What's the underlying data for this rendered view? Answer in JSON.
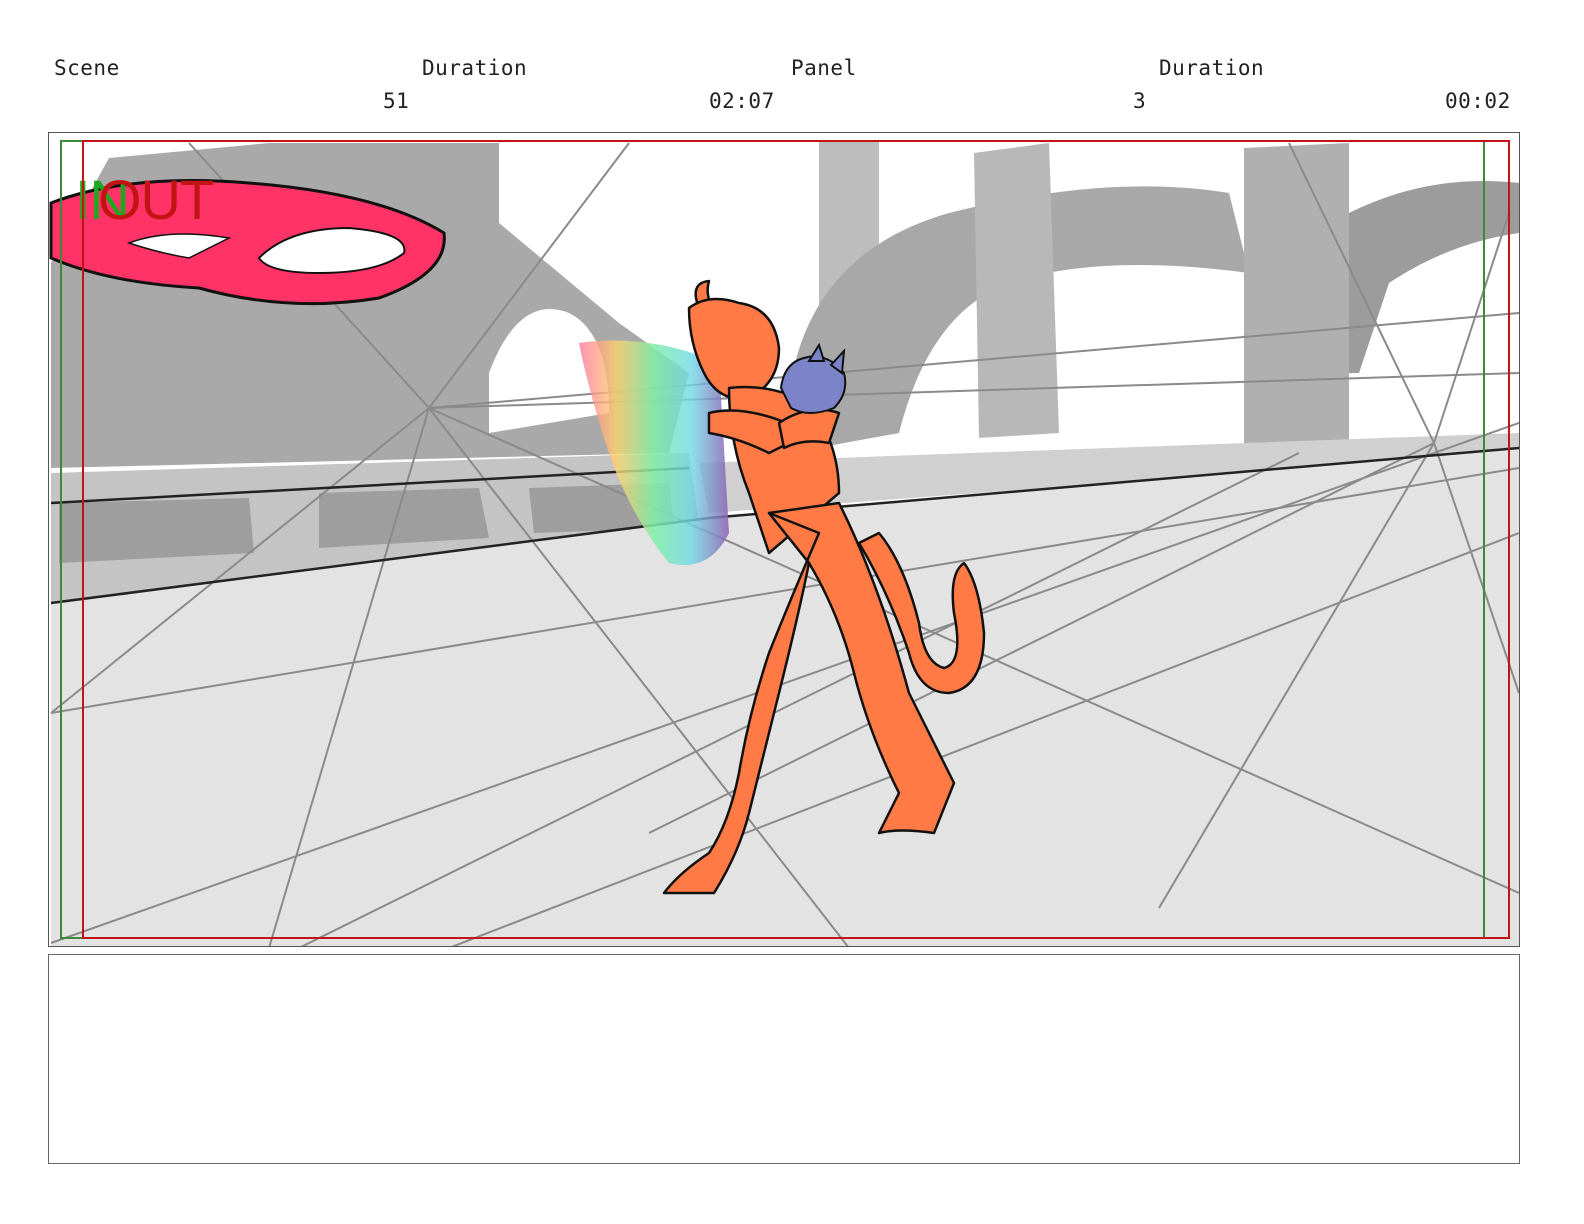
{
  "header": {
    "scene_label": "Scene",
    "scene_duration_label": "Duration",
    "panel_label": "Panel",
    "panel_duration_label": "Duration",
    "scene_number": "51",
    "scene_duration": "02:07",
    "panel_number": "3",
    "panel_duration": "00:02"
  },
  "frame": {
    "in_marker": "IN",
    "out_marker": "OUT",
    "in_color": "#1fa81f",
    "out_color": "#c21414",
    "character_color": "#ff7a45",
    "creature_color": "#7b84c9",
    "effect_color": "#ff3366"
  },
  "notes": {
    "text": ""
  }
}
